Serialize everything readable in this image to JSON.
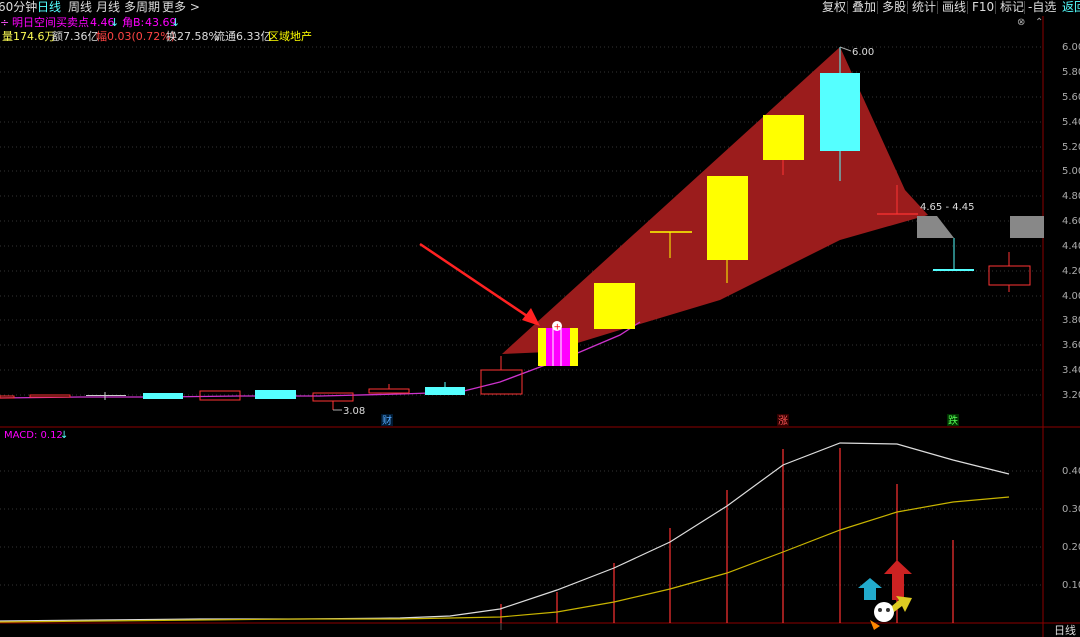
{
  "toolbar": {
    "periods": [
      "60分钟",
      "日线",
      "周线",
      "月线",
      "多周期",
      "更多 >"
    ],
    "active_period": "日线",
    "actions": [
      "复权",
      "叠加",
      "多股",
      "统计",
      "画线",
      "F10",
      "标记",
      "-自选",
      "返回"
    ]
  },
  "indicator_line": {
    "prefix": "÷",
    "name": "明日空间买卖点",
    "value": "4.46",
    "value_arrow": "↓",
    "angle_label": "角B:",
    "angle_value": "43.69",
    "angle_arrow": "↓"
  },
  "stats_line": {
    "volume": "量174.6万",
    "amount": "额7.36亿",
    "change": "幅0.03(0.72%)",
    "turnover": "换27.58%",
    "float": "流通6.33亿",
    "sector": "区域地产"
  },
  "annotations": {
    "high_label": "6.00",
    "low_label": "3.08",
    "range_label": "4.65 - 4.45",
    "event_cai": "财",
    "event_zhang": "涨",
    "event_die": "跌"
  },
  "macd": {
    "label": "MACD: 0.12",
    "arrow": "↓"
  },
  "bottom_tab": "日线",
  "colors": {
    "up": "#ff3333",
    "down": "#55ffff",
    "signal_yellow": "#ffff00",
    "signal_magenta": "#ff00ff",
    "fill_red": "#9b1c1c",
    "gray_box": "#888888",
    "dif_line": "#dddddd",
    "dea_line": "#c8b400"
  },
  "chart_data": {
    "type": "candlestick",
    "price_axis": {
      "ylim": [
        3.1,
        6.1
      ],
      "ticks": [
        "6.00",
        "5.80",
        "5.60",
        "5.40",
        "5.20",
        "5.00",
        "4.80",
        "4.60",
        "4.40",
        "4.20",
        "4.00",
        "3.80",
        "3.60",
        "3.40",
        "3.20"
      ]
    },
    "macd_axis": {
      "ticks": [
        "0.40",
        "0.30",
        "0.20",
        "0.10"
      ]
    }
  }
}
